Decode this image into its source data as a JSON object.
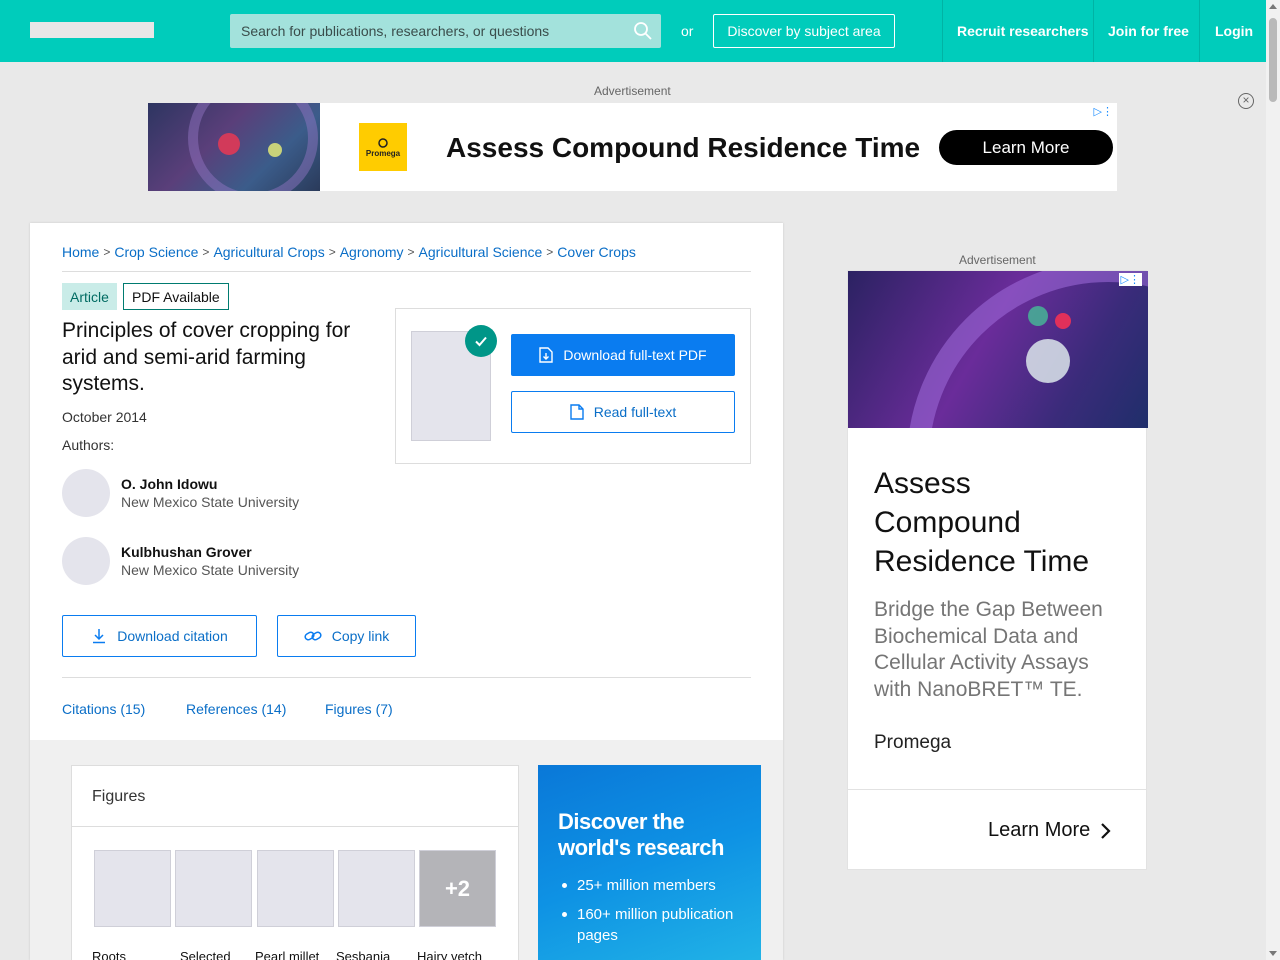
{
  "nav": {
    "search_placeholder": "Search for publications, researchers, or questions",
    "or_text": "or",
    "discover_label": "Discover by subject area",
    "recruit_label": "Recruit researchers",
    "join_label": "Join for free",
    "login_label": "Login"
  },
  "top_ad": {
    "label": "Advertisement",
    "brand": "Promega",
    "headline": "Assess Compound Residence Time",
    "cta": "Learn More",
    "close_symbol": "×"
  },
  "breadcrumb": [
    "Home",
    "Crop Science",
    "Agricultural Crops",
    "Agronomy",
    "Agricultural Science",
    "Cover Crops"
  ],
  "article": {
    "type_badge": "Article",
    "pdf_badge": "PDF Available",
    "title": "Principles of cover cropping for arid and semi-arid farming systems.",
    "date": "October 2014",
    "authors_label": "Authors:",
    "authors": [
      {
        "name": "O. John Idowu",
        "institution": "New Mexico State University"
      },
      {
        "name": "Kulbhushan Grover",
        "institution": "New Mexico State University"
      }
    ],
    "download_pdf": "Download full-text PDF",
    "read_fulltext": "Read full-text",
    "download_citation": "Download citation",
    "copy_link": "Copy link"
  },
  "tabs": [
    "Citations (15)",
    "References (14)",
    "Figures (7)"
  ],
  "figures": {
    "heading": "Figures",
    "more": "+2",
    "captions": [
      "Roots",
      "Selected",
      "Pearl millet",
      "Sesbania",
      "Hairy vetch"
    ]
  },
  "discover": {
    "heading": "Discover the world's research",
    "items": [
      "25+ million members",
      "160+ million publication pages"
    ]
  },
  "right_ad": {
    "label": "Advertisement",
    "headline": "Assess Compound Residence Time",
    "subtext": "Bridge the Gap Between Biochemical Data and Cellular Activity Assays with NanoBRET™ TE.",
    "brand": "Promega",
    "cta": "Learn More"
  },
  "colors": {
    "brand_teal": "#00ccbb",
    "link_blue": "#0a6ec7",
    "primary_button": "#0a7cf0"
  },
  "icons": [
    "search-icon",
    "close-icon",
    "check-icon",
    "download-icon",
    "file-icon",
    "link-icon",
    "chevron-right-icon",
    "adchoices-icon"
  ]
}
